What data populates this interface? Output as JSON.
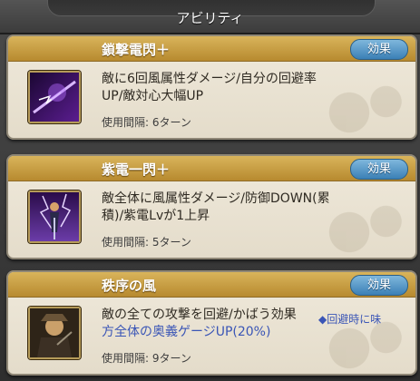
{
  "header": {
    "title": "アビリティ"
  },
  "abilities": [
    {
      "name": "鎖撃電閃＋",
      "button": "効果",
      "desc_lines": [
        "敵に6回風属性ダメージ/自分の回避率",
        "UP/敵対心大幅UP"
      ],
      "interval": "使用間隔: 6ターン",
      "icon": "purple-lightning-slash-icon"
    },
    {
      "name": "紫電一閃＋",
      "button": "効果",
      "desc_lines": [
        "敵全体に風属性ダメージ/防御DOWN(累",
        "積)/紫電Lvが1上昇"
      ],
      "interval": "使用間隔: 5ターン",
      "icon": "swordsman-lightning-icon"
    },
    {
      "name": "秩序の風",
      "button": "効果",
      "desc_lines": [
        "敵の全ての攻撃を回避/かばう効果",
        "方全体の奥義ゲージUP(20%)"
      ],
      "note": "◆回避時に味",
      "interval": "使用間隔: 9ターン",
      "icon": "dark-knight-portrait-icon"
    }
  ],
  "colors": {
    "card_header_gold": "#c99b3f",
    "effect_button_blue": "#3b80b6",
    "highlight_text_blue": "#3a55b6"
  }
}
